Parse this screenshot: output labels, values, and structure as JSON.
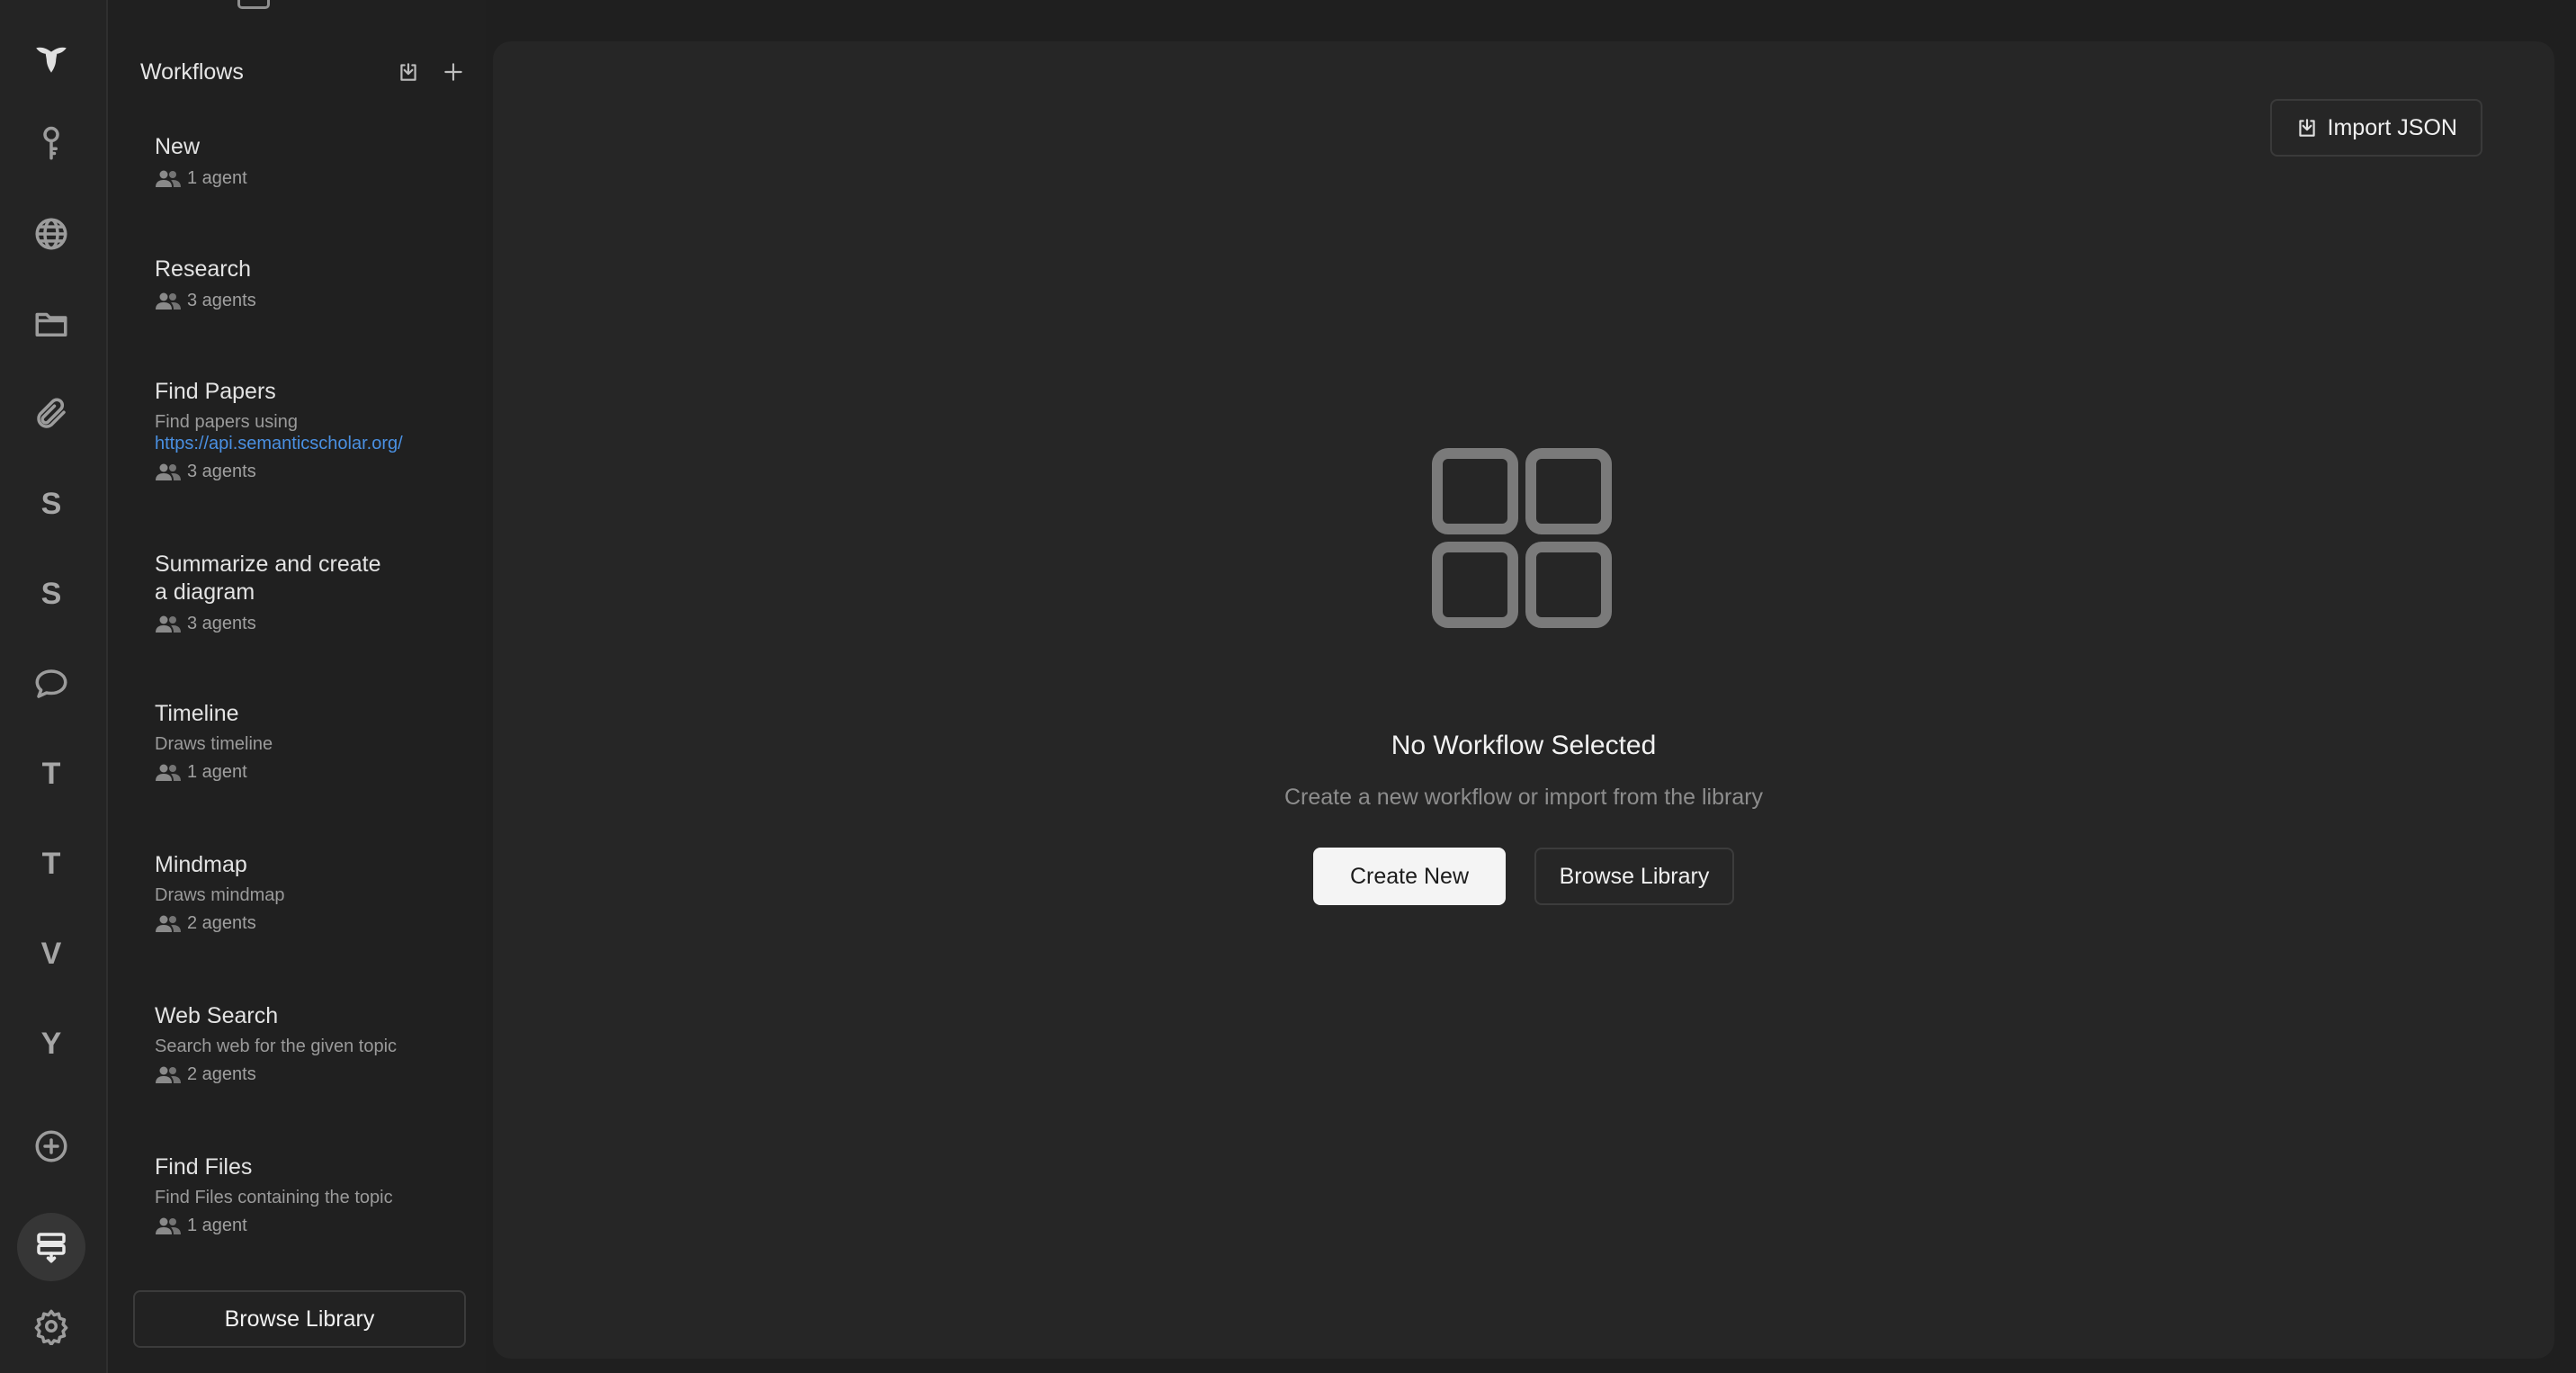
{
  "sidebar": {
    "title": "Workflows",
    "items": [
      {
        "name": "New",
        "description": "",
        "agents": "1 agent"
      },
      {
        "name": "Research",
        "description": "",
        "agents": "3 agents"
      },
      {
        "name": "Find Papers",
        "description": "Find papers using ",
        "link": "https://api.semanticscholar.org/",
        "agents": "3 agents"
      },
      {
        "name": "Summarize and create a diagram",
        "description": "",
        "agents": "3 agents"
      },
      {
        "name": "Timeline",
        "description": "Draws timeline",
        "agents": "1 agent"
      },
      {
        "name": "Mindmap",
        "description": "Draws mindmap",
        "agents": "2 agents"
      },
      {
        "name": "Web Search",
        "description": "Search web for the given topic",
        "agents": "2 agents"
      },
      {
        "name": "Find Files",
        "description": "Find Files containing the topic",
        "agents": "1 agent"
      }
    ],
    "browse_label": "Browse Library"
  },
  "rail": {
    "letters": [
      "S",
      "S",
      "T",
      "T",
      "V",
      "Y"
    ]
  },
  "main": {
    "import_label": "Import JSON",
    "empty_title": "No Workflow Selected",
    "empty_subtitle": "Create a new workflow or import from the library",
    "create_label": "Create New",
    "browse_label": "Browse Library"
  }
}
